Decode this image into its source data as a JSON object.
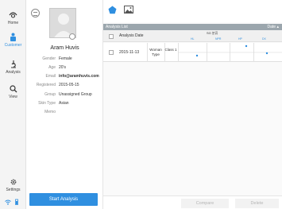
{
  "nav": {
    "items": [
      {
        "label": "Home",
        "icon": "home-icon"
      },
      {
        "label": "Customer",
        "icon": "customer-icon"
      },
      {
        "label": "Analysis",
        "icon": "analysis-icon"
      },
      {
        "label": "View",
        "icon": "search-icon"
      },
      {
        "label": "Settings",
        "icon": "gear-icon"
      }
    ],
    "active_color": "#2f8fe0"
  },
  "profile": {
    "name": "Aram Huvis",
    "fields": [
      {
        "key": "Gender",
        "value": "Female"
      },
      {
        "key": "Age",
        "value": "20's"
      },
      {
        "key": "Email",
        "value": "info@aramhuvis.com"
      },
      {
        "key": "Registered",
        "value": "2015-05-15"
      },
      {
        "key": "Group",
        "value": "Unassigned Group"
      },
      {
        "key": "Skin Type",
        "value": "Asian"
      },
      {
        "key": "Memo",
        "value": ""
      }
    ],
    "start_button": "Start Analysis"
  },
  "list": {
    "title": "Analysis List",
    "sort_label": "Date ▴",
    "header": {
      "date": "Analysis Date",
      "skin_group": "SG 분류",
      "columns": [
        "HL",
        "NPR",
        "HP",
        "DX"
      ]
    },
    "rows": [
      {
        "date": "2015-11-13",
        "type": "Woman Type",
        "class": "Class 1"
      }
    ]
  },
  "actions": {
    "compare": "Compare",
    "delete": "Delete"
  },
  "colors": {
    "accent": "#2f8fe0",
    "list_bar": "#9ba6ad"
  }
}
